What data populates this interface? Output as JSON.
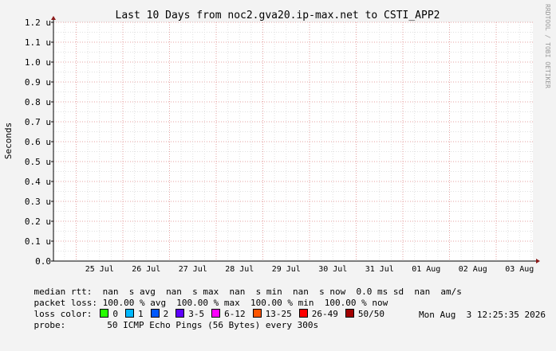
{
  "chart_data": {
    "type": "line",
    "title": "Last 10 Days from noc2.gva20.ip-max.net to CSTI_APP2",
    "ylabel": "Seconds",
    "xlabel": "",
    "ylim": [
      0,
      1.2e-06
    ],
    "y_ticks": [
      "0.0",
      "0.1 u",
      "0.2 u",
      "0.3 u",
      "0.4 u",
      "0.5 u",
      "0.6 u",
      "0.7 u",
      "0.8 u",
      "0.9 u",
      "1.0 u",
      "1.1 u",
      "1.2 u"
    ],
    "x_ticks": [
      "25 Jul",
      "26 Jul",
      "27 Jul",
      "28 Jul",
      "29 Jul",
      "30 Jul",
      "31 Jul",
      "01 Aug",
      "02 Aug",
      "03 Aug"
    ],
    "series": [],
    "watermark": "RRDTOOL / TOBI OETIKER",
    "grid": true
  },
  "legend": {
    "median_rtt": "median rtt:  nan  s avg  nan  s max  nan  s min  nan  s now  0.0 ms sd  nan  am/s",
    "packet_loss": "packet loss: 100.00 % avg  100.00 % max  100.00 % min  100.00 % now",
    "loss_color_label": "loss color:",
    "loss_colors": [
      {
        "label": "0",
        "color": "#26ff00"
      },
      {
        "label": "1",
        "color": "#00b8ff"
      },
      {
        "label": "2",
        "color": "#0059ff"
      },
      {
        "label": "3-5",
        "color": "#5e00ff"
      },
      {
        "label": "6-12",
        "color": "#ff00ff"
      },
      {
        "label": "13-25",
        "color": "#ff5500"
      },
      {
        "label": "26-49",
        "color": "#ff0000"
      },
      {
        "label": "50/50",
        "color": "#a10000"
      }
    ],
    "probe_label": "probe:",
    "probe_text": "50 ICMP Echo Pings (56 Bytes) every 300s",
    "timestamp": "Mon Aug  3 12:25:35 2026"
  },
  "colors": {
    "background": "#f3f3f3",
    "plot_area": "#ffffff",
    "major_grid": "#e5a0a0",
    "minor_grid": "#e0e0e0",
    "axis": "#000000",
    "arrow": "#8b1a1a",
    "watermark": "#999999"
  }
}
